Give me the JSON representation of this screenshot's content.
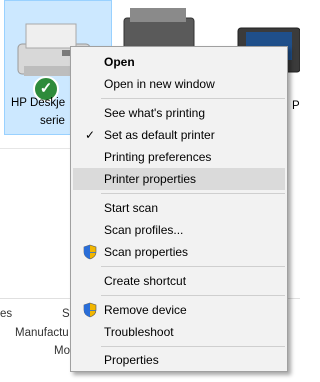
{
  "devices": [
    {
      "label_line1": "HP Deskje",
      "label_line2": "serie"
    },
    {
      "label": "P"
    }
  ],
  "details": [
    "es",
    "St",
    "Manufactu",
    "Mo"
  ],
  "context_menu": {
    "items": [
      {
        "label": "Open",
        "bold": true
      },
      {
        "label": "Open in new window"
      },
      {
        "label": "See what's printing"
      },
      {
        "label": "Set as default printer",
        "icon": "checkmark-icon",
        "checked": true
      },
      {
        "label": "Printing preferences"
      },
      {
        "label": "Printer properties",
        "highlighted": true
      },
      {
        "label": "Start scan"
      },
      {
        "label": "Scan profiles..."
      },
      {
        "label": "Scan properties",
        "icon": "uac-shield-icon"
      },
      {
        "label": "Create shortcut"
      },
      {
        "label": "Remove device",
        "icon": "uac-shield-icon"
      },
      {
        "label": "Troubleshoot"
      },
      {
        "label": "Properties"
      }
    ]
  },
  "colors": {
    "selection_bg": "#cce8ff",
    "menu_bg": "#f2f2f2",
    "menu_highlight": "#dadada",
    "default_badge": "#2e8b3b"
  }
}
